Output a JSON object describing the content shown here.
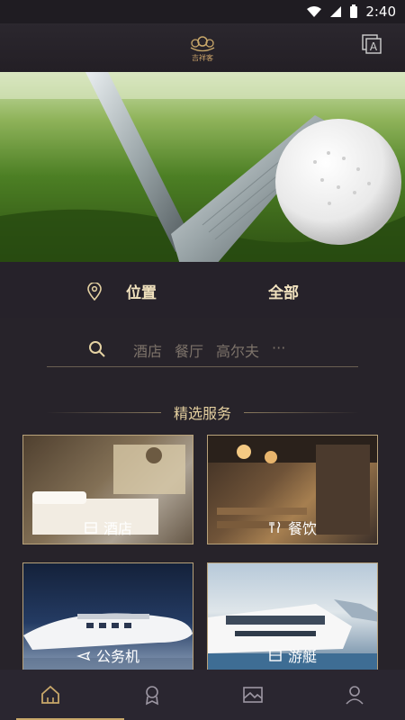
{
  "status_bar": {
    "time": "2:40"
  },
  "header": {
    "logo_text": "吉祥客",
    "translate_icon": "translate-icon"
  },
  "banner": {
    "image": "golf-club-and-ball"
  },
  "filters": {
    "location_label": "位置",
    "all_label": "全部"
  },
  "search": {
    "chips": [
      "酒店",
      "餐厅",
      "高尔夫"
    ],
    "more": "···"
  },
  "section": {
    "title": "精选服务"
  },
  "services": [
    {
      "label": "酒店",
      "icon": "hotel-icon"
    },
    {
      "label": "餐饮",
      "icon": "dining-icon"
    },
    {
      "label": "公务机",
      "icon": "jet-icon"
    },
    {
      "label": "游艇",
      "icon": "yacht-icon"
    }
  ],
  "tabbar": {
    "items": [
      "home-icon",
      "award-icon",
      "gallery-icon",
      "profile-icon"
    ],
    "active_index": 0
  },
  "colors": {
    "accent": "#c9a86a",
    "background": "#27232a"
  }
}
